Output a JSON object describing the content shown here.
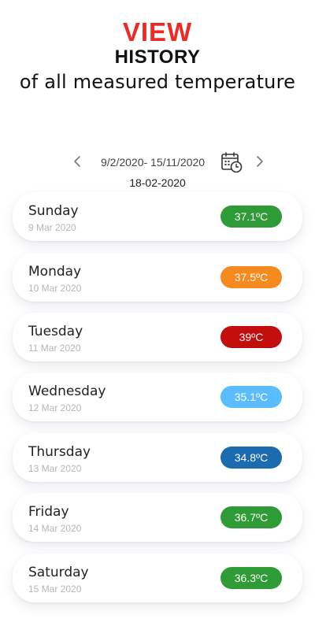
{
  "hero": {
    "line1": "VIEW",
    "line2": "HISTORY",
    "line3": "of all measured temperature"
  },
  "range": {
    "prev_icon": "chevron-left-icon",
    "text": "9/2/2020- 15/11/2020",
    "calendar_icon": "calendar-clock-icon",
    "next_icon": "chevron-right-icon",
    "selected_date": "18-02-2020"
  },
  "colors": {
    "accent_red": "#ee2a24",
    "green": "#2e9b36",
    "orange": "#f68a1e",
    "red": "#c40d0d",
    "light_blue": "#5bbcff",
    "blue": "#1b6bb0"
  },
  "entries": [
    {
      "day": "Sunday",
      "date": "9 Mar 2020",
      "temp": "37.1ºC",
      "color": "#2e9b36"
    },
    {
      "day": "Monday",
      "date": "10 Mar 2020",
      "temp": "37.5ºC",
      "color": "#f68a1e"
    },
    {
      "day": "Tuesday",
      "date": "11 Mar 2020",
      "temp": "39ºC",
      "color": "#c40d0d"
    },
    {
      "day": "Wednesday",
      "date": "12 Mar 2020",
      "temp": "35.1ºC",
      "color": "#5bbcff"
    },
    {
      "day": "Thursday",
      "date": "13 Mar 2020",
      "temp": "34.8ºC",
      "color": "#1b6bb0"
    },
    {
      "day": "Friday",
      "date": "14 Mar 2020",
      "temp": "36.7ºC",
      "color": "#2e9b36"
    },
    {
      "day": "Saturday",
      "date": "15 Mar 2020",
      "temp": "36.3ºC",
      "color": "#2e9b36"
    }
  ]
}
